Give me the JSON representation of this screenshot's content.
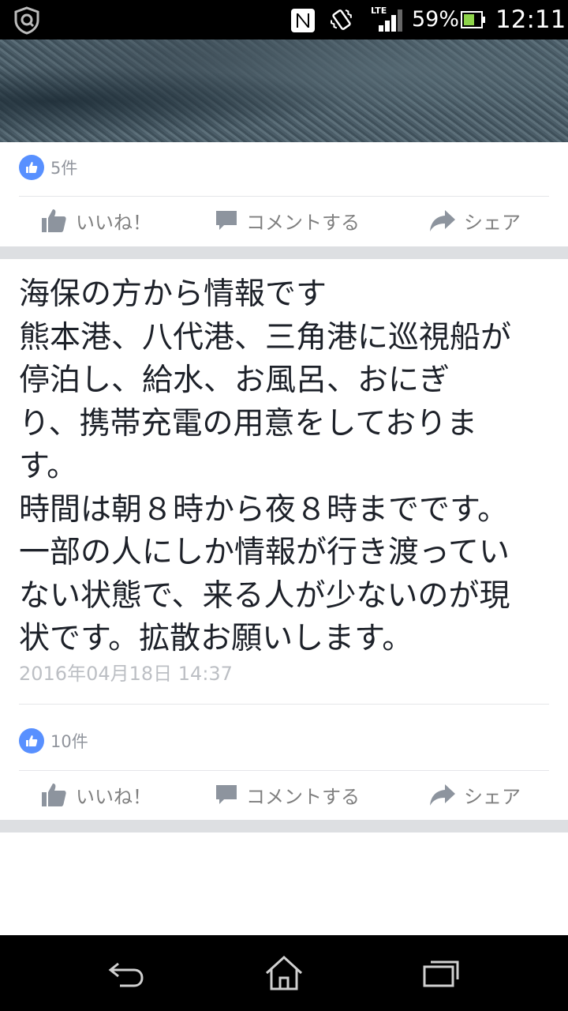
{
  "status_bar": {
    "battery_percent": "59%",
    "time": "12:11",
    "network": "LTE"
  },
  "post1": {
    "like_count": "5件",
    "actions": {
      "like": "いいね！",
      "comment": "コメントする",
      "share": "シェア"
    }
  },
  "post2": {
    "text": "海保の方から情報です\n熊本港、八代港、三角港に巡視船が\n停泊し、給水、お風呂、おにぎ\nり、携帯充電の用意をしておりま\nす。\n時間は朝８時から夜８時までです。\n一部の人にしか情報が行き渡ってい\nない状態で、来る人が少ないのが現\n状です。拡散お願いします。",
    "timestamp": "2016年04月18日 14:37",
    "like_count": "10件",
    "actions": {
      "like": "いいね！",
      "comment": "コメントする",
      "share": "シェア"
    }
  },
  "colors": {
    "like_blue": "#5890ff",
    "action_gray": "#7f7f7f",
    "separator": "#dddfe2"
  }
}
